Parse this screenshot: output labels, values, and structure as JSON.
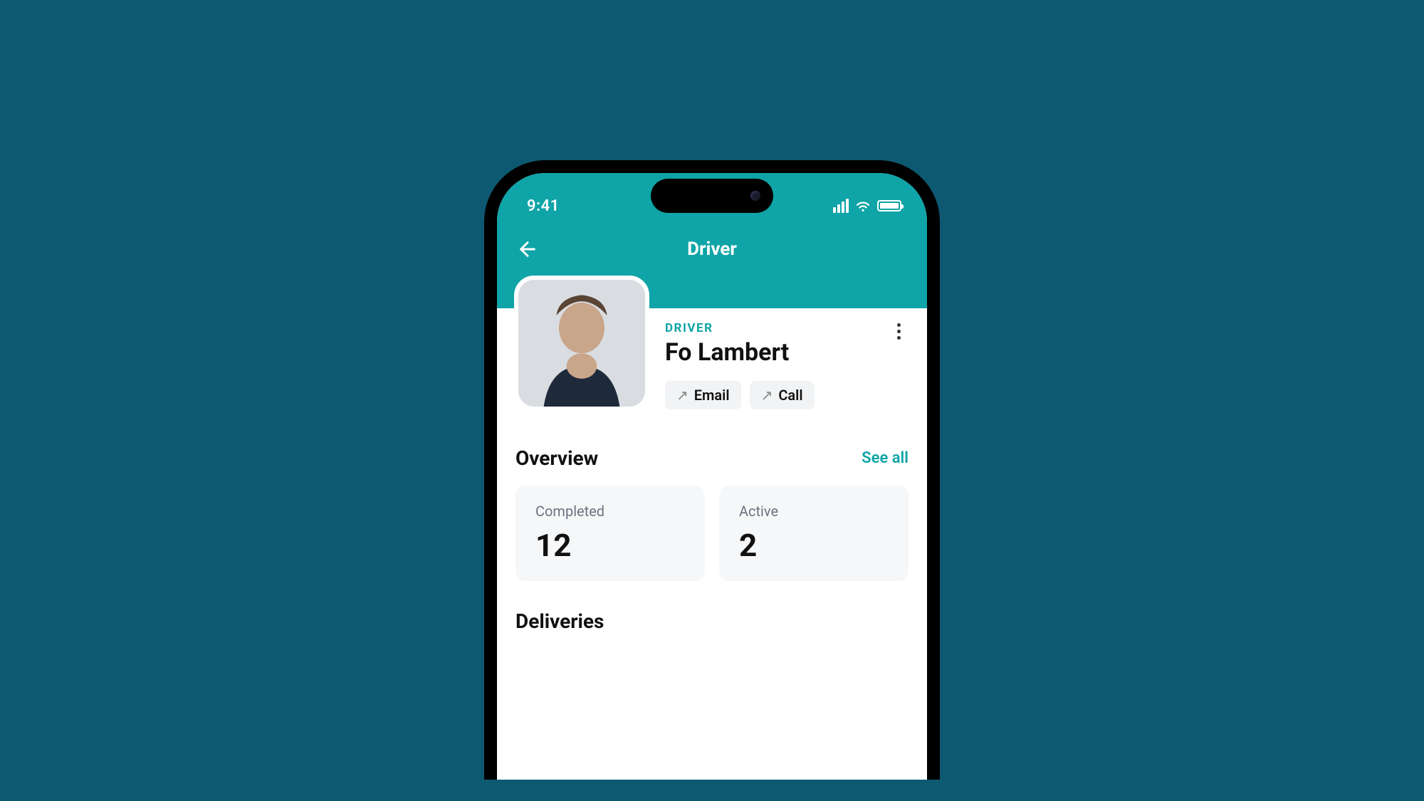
{
  "statusBar": {
    "time": "9:41"
  },
  "appBar": {
    "title": "Driver"
  },
  "profile": {
    "roleLabel": "DRIVER",
    "name": "Fo Lambert",
    "actions": {
      "email": "Email",
      "call": "Call"
    }
  },
  "overview": {
    "title": "Overview",
    "seeAll": "See all",
    "stats": [
      {
        "label": "Completed",
        "value": "12"
      },
      {
        "label": "Active",
        "value": "2"
      }
    ]
  },
  "deliveries": {
    "title": "Deliveries"
  }
}
